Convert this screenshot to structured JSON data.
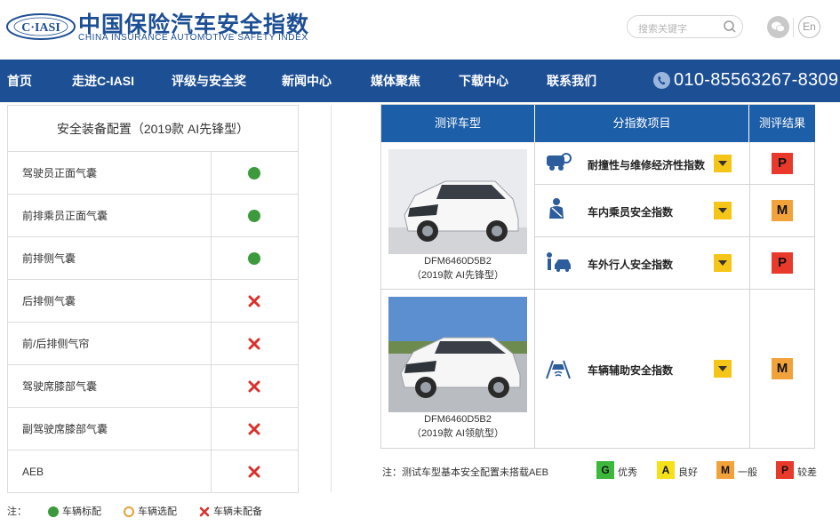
{
  "header": {
    "logo_text": "C·IASI",
    "brand_cn": "中国保险汽车安全指数",
    "brand_en": "CHINA INSURANCE AUTOMOTIVE SAFETY INDEX",
    "search_placeholder": "搜索关键字",
    "search_icon": "search-icon",
    "wechat_icon": "wechat-icon",
    "lang_label": "En"
  },
  "nav": {
    "items": [
      "首页",
      "走进C-IASI",
      "评级与安全奖",
      "新闻中心",
      "媒体聚焦",
      "下载中心",
      "联系我们"
    ],
    "phone": "010-85563267-8309",
    "phone_icon": "phone-icon"
  },
  "equipment": {
    "title": "安全装备配置（2019款 AI先锋型）",
    "rows": [
      {
        "label": "驾驶员正面气囊",
        "status": "standard"
      },
      {
        "label": "前排乘员正面气囊",
        "status": "standard"
      },
      {
        "label": "前排侧气囊",
        "status": "standard"
      },
      {
        "label": "后排侧气囊",
        "status": "none"
      },
      {
        "label": "前/后排侧气帘",
        "status": "none"
      },
      {
        "label": "驾驶席膝部气囊",
        "status": "none"
      },
      {
        "label": "副驾驶席膝部气囊",
        "status": "none"
      },
      {
        "label": "AEB",
        "status": "none"
      }
    ],
    "legend": {
      "prefix": "注：",
      "standard": "车辆标配",
      "optional": "车辆选配",
      "none": "车辆未配备"
    }
  },
  "results": {
    "headers": {
      "model": "测评车型",
      "index": "分指数项目",
      "result": "测评结果"
    },
    "cars": [
      {
        "code": "DFM6460D5B2",
        "trim": "（2019款 AI先锋型）"
      },
      {
        "code": "DFM6460D5B2",
        "trim": "（2019款 AI领航型）"
      }
    ],
    "indices": [
      {
        "label": "耐撞性与维修经济性指数",
        "icon": "crash-repair-icon",
        "grade": "P"
      },
      {
        "label": "车内乘员安全指数",
        "icon": "occupant-icon",
        "grade": "M"
      },
      {
        "label": "车外行人安全指数",
        "icon": "pedestrian-icon",
        "grade": "P"
      },
      {
        "label": "车辆辅助安全指数",
        "icon": "assist-icon",
        "grade": "M"
      }
    ],
    "note": "注：测试车型基本安全配置未搭载AEB",
    "grade_legend": [
      {
        "grade": "G",
        "label": "优秀",
        "color": "#3db83d"
      },
      {
        "grade": "A",
        "label": "良好",
        "color": "#f5e11a"
      },
      {
        "grade": "M",
        "label": "一般",
        "color": "#f2a23b"
      },
      {
        "grade": "P",
        "label": "较差",
        "color": "#e8392b"
      }
    ]
  }
}
